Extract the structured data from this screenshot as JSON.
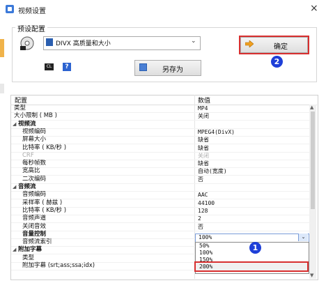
{
  "window": {
    "title": "视频设置",
    "close_glyph": "×",
    "icon": "app-icon"
  },
  "preset": {
    "group_label": "预设配置",
    "selected": "DIVX 高质量和大小",
    "ok_label": "确定",
    "saveas_label": "另存为",
    "small_icon_text": "CL",
    "help_text": "?"
  },
  "annotations": {
    "badge_1": "1",
    "badge_2": "2"
  },
  "grid": {
    "header_name": "配置",
    "header_value": "数值",
    "rows": [
      {
        "name": "类型",
        "value": "MP4",
        "kind": "item"
      },
      {
        "name": "大小限制 ( MB )",
        "value": "关闭",
        "kind": "item"
      },
      {
        "name": "视频流",
        "value": "",
        "kind": "cat"
      },
      {
        "name": "视频编码",
        "value": "MPEG4(DivX)",
        "kind": "indent"
      },
      {
        "name": "屏幕大小",
        "value": "缺省",
        "kind": "indent"
      },
      {
        "name": "比特率 ( KB/秒 )",
        "value": "缺省",
        "kind": "indent"
      },
      {
        "name": "CRF",
        "value": "关闭",
        "kind": "disabled"
      },
      {
        "name": "每秒帧数",
        "value": "缺省",
        "kind": "indent"
      },
      {
        "name": "宽高比",
        "value": "自动(宽度)",
        "kind": "indent"
      },
      {
        "name": "二次编码",
        "value": "否",
        "kind": "indent"
      },
      {
        "name": "音频流",
        "value": "",
        "kind": "cat"
      },
      {
        "name": "音频编码",
        "value": "AAC",
        "kind": "indent"
      },
      {
        "name": "采样率 ( 赫兹 )",
        "value": "44100",
        "kind": "indent"
      },
      {
        "name": "比特率 ( KB/秒 )",
        "value": "128",
        "kind": "indent"
      },
      {
        "name": "音频声道",
        "value": "2",
        "kind": "indent"
      },
      {
        "name": "关闭音效",
        "value": "否",
        "kind": "indent"
      },
      {
        "name": "音量控制",
        "value": "",
        "kind": "selected"
      },
      {
        "name": "音频流索引",
        "value": "",
        "kind": "indent"
      },
      {
        "name": "附加字幕",
        "value": "",
        "kind": "cat"
      },
      {
        "name": "类型",
        "value": "",
        "kind": "indent"
      },
      {
        "name": "附加字幕 (srt;ass;ssa;idx)",
        "value": "",
        "kind": "indent"
      }
    ]
  },
  "combo": {
    "value": "100%",
    "button_glyph": "⌄",
    "options": [
      "50%",
      "100%",
      "150%",
      "200%"
    ],
    "highlighted_index": 3
  },
  "scroll": {
    "up_glyph": "▲",
    "down_glyph": "▼"
  },
  "colors": {
    "highlight_red": "#d82f2f",
    "badge_blue": "#1e3fd8"
  }
}
